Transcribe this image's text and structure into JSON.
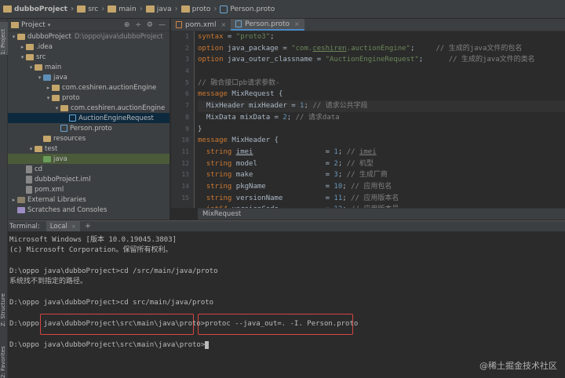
{
  "breadcrumb": [
    {
      "label": "dubboProject",
      "icon": "folder-icon"
    },
    {
      "label": "src",
      "icon": "folder-icon"
    },
    {
      "label": "main",
      "icon": "folder-icon"
    },
    {
      "label": "java",
      "icon": "folder-icon"
    },
    {
      "label": "proto",
      "icon": "folder-icon"
    },
    {
      "label": "Person.proto",
      "icon": "proto-file-icon"
    }
  ],
  "sidebar": {
    "project_label": "1: Project",
    "structure_label": "Z: Structure",
    "favorites_label": "2: Favorites"
  },
  "project_panel": {
    "title": "Project",
    "tree": [
      {
        "label": "dubboProject",
        "extra": "D:\\oppo\\java\\dubboProject",
        "level": 0,
        "arrow": "▾",
        "icon": "ic-folder"
      },
      {
        "label": ".idea",
        "level": 1,
        "arrow": "▸",
        "icon": "ic-folder"
      },
      {
        "label": "src",
        "level": 1,
        "arrow": "▾",
        "icon": "ic-folder"
      },
      {
        "label": "main",
        "level": 2,
        "arrow": "▾",
        "icon": "ic-folder"
      },
      {
        "label": "java",
        "level": 3,
        "arrow": "▾",
        "icon": "ic-src"
      },
      {
        "label": "com.ceshiren.auctionEngine",
        "level": 4,
        "arrow": "▸",
        "icon": "ic-pkg"
      },
      {
        "label": "proto",
        "level": 4,
        "arrow": "▾",
        "icon": "ic-pkg"
      },
      {
        "label": "com.ceshiren.auctionEngine",
        "level": 5,
        "arrow": "▾",
        "icon": "ic-pkg"
      },
      {
        "label": "AuctionEngineRequest",
        "level": 6,
        "arrow": "",
        "icon": "ic-proto",
        "selected": true
      },
      {
        "label": "Person.proto",
        "level": 5,
        "arrow": "",
        "icon": "ic-proto"
      },
      {
        "label": "resources",
        "level": 3,
        "arrow": "",
        "icon": "ic-folder"
      },
      {
        "label": "test",
        "level": 2,
        "arrow": "▾",
        "icon": "ic-folder"
      },
      {
        "label": "java",
        "level": 3,
        "arrow": "",
        "icon": "ic-test",
        "selected2": true
      },
      {
        "label": "cd",
        "level": 1,
        "arrow": "",
        "icon": "ic-file"
      },
      {
        "label": "dubboProject.iml",
        "level": 1,
        "arrow": "",
        "icon": "ic-file"
      },
      {
        "label": "pom.xml",
        "level": 1,
        "arrow": "",
        "icon": "ic-file"
      },
      {
        "label": "External Libraries",
        "level": 0,
        "arrow": "▸",
        "icon": "ic-lib"
      },
      {
        "label": "Scratches and Consoles",
        "level": 0,
        "arrow": "",
        "icon": "ic-scratch"
      }
    ]
  },
  "editor": {
    "tabs": [
      {
        "label": "pom.xml",
        "active": false
      },
      {
        "label": "Person.proto",
        "active": true
      }
    ],
    "line_numbers": [
      "1",
      "2",
      "3",
      "4",
      "5",
      "6",
      "7",
      "8",
      "9",
      "10",
      "11",
      "12",
      "13",
      "14",
      "15"
    ],
    "status_text": "MixRequest"
  },
  "terminal": {
    "header_title": "Terminal:",
    "tab_label": "Local",
    "lines": [
      "Microsoft Windows [版本 10.0.19045.3803]",
      "(c) Microsoft Corporation。保留所有权利。",
      "",
      "D:\\oppo java\\dubboProject>cd /src/main/java/proto",
      "系统找不到指定的路径。",
      "",
      "D:\\oppo java\\dubboProject>cd src/main/java/proto",
      "",
      "D:\\oppo java\\dubboProject\\src\\main\\java\\proto>protoc --java_out=. -I. Person.proto",
      "",
      "D:\\oppo java\\dubboProject\\src\\main\\java\\proto>"
    ]
  },
  "watermark": "@稀土掘金技术社区"
}
